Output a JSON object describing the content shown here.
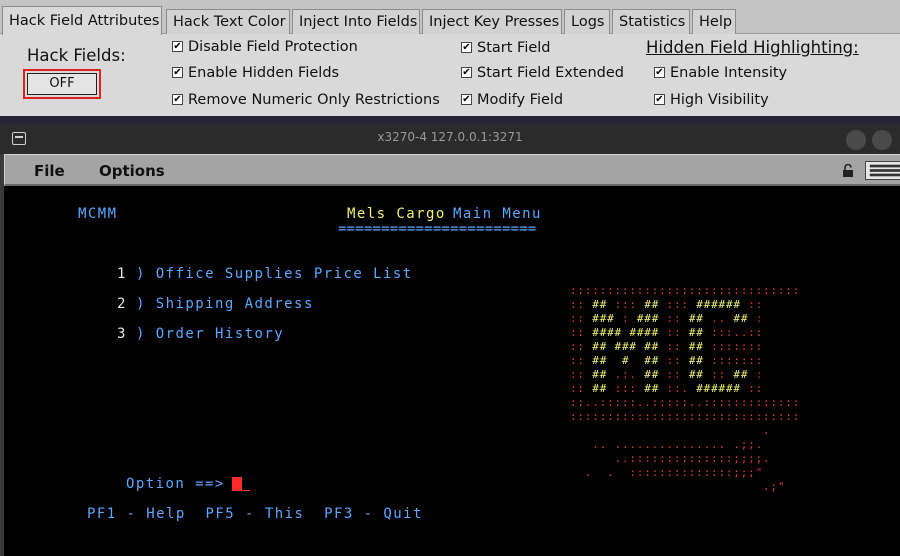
{
  "tabs": [
    {
      "label": "Hack Field Attributes",
      "active": true
    },
    {
      "label": "Hack Text Color"
    },
    {
      "label": "Inject Into Fields"
    },
    {
      "label": "Inject Key Presses"
    },
    {
      "label": "Logs"
    },
    {
      "label": "Statistics"
    },
    {
      "label": "Help"
    }
  ],
  "hack_fields": {
    "title": "Hack Fields:",
    "toggle_label": "OFF"
  },
  "options_col1": [
    {
      "label": "Disable Field Protection",
      "checked": true
    },
    {
      "label": "Enable Hidden Fields",
      "checked": true
    },
    {
      "label": "Remove Numeric Only Restrictions",
      "checked": true
    }
  ],
  "options_col2": [
    {
      "label": "Start Field",
      "checked": true
    },
    {
      "label": "Start Field Extended",
      "checked": true
    },
    {
      "label": "Modify Field",
      "checked": true
    }
  ],
  "highlighting": {
    "title": "Hidden Field Highlighting:",
    "options": [
      {
        "label": "Enable Intensity",
        "checked": true
      },
      {
        "label": "High Visibility",
        "checked": true
      }
    ]
  },
  "window": {
    "title": "x3270-4 127.0.0.1:3271"
  },
  "menubar": {
    "file": "File",
    "options": "Options"
  },
  "terminal": {
    "screen_id": "MCMM",
    "title_a": "Mels Cargo",
    "title_b": "Main Menu",
    "underline": "=======================",
    "menu_items": [
      {
        "number": "1",
        "label": ") Office Supplies Price List"
      },
      {
        "number": "2",
        "label": ") Shipping Address"
      },
      {
        "number": "3",
        "label": ") Order History"
      }
    ],
    "option_prompt": "Option ==>",
    "pf_keys": "PF1 - Help  PF5 - This  PF3 - Quit"
  },
  "colors": {
    "terminal_bg": "#000000",
    "field_text": "#5aa8ff",
    "highlight_text": "#f2f26e",
    "protected_text": "#e33a3a",
    "toggle_border": "#e12020"
  },
  "icons": [
    "terminal-app-icon",
    "lock-open-icon",
    "keyboard-icon",
    "check-icon"
  ]
}
